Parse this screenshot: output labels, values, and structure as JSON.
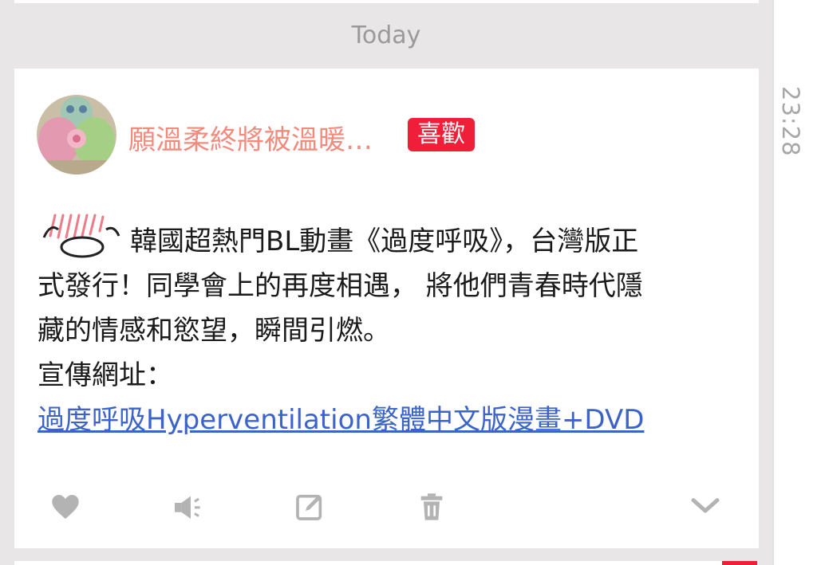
{
  "divider": {
    "label": "Today"
  },
  "rail": {
    "time": "23:28"
  },
  "post": {
    "author": "願溫柔終將被溫暖…",
    "badge": "喜歡",
    "lines": [
      "韓國超熱門BL動畫《過度呼吸》，台灣版正",
      "式發行！同學會上的再度相遇， 將他們青春時代隱",
      "藏的情感和慾望，瞬間引燃。",
      "宣傳網址："
    ],
    "link_text": "過度呼吸Hyperventilation繁體中文版漫畫+DVD"
  },
  "actions": [
    {
      "icon": "heart-icon"
    },
    {
      "icon": "megaphone-icon"
    },
    {
      "icon": "edit-icon"
    },
    {
      "icon": "trash-icon"
    },
    {
      "icon": "chevron-down-icon"
    }
  ],
  "colors": {
    "accent": "#ef1f3a",
    "username": "#f08b7e",
    "link": "#3b63c9",
    "icon": "#b3b3b3",
    "background": "#e8e6e7"
  }
}
